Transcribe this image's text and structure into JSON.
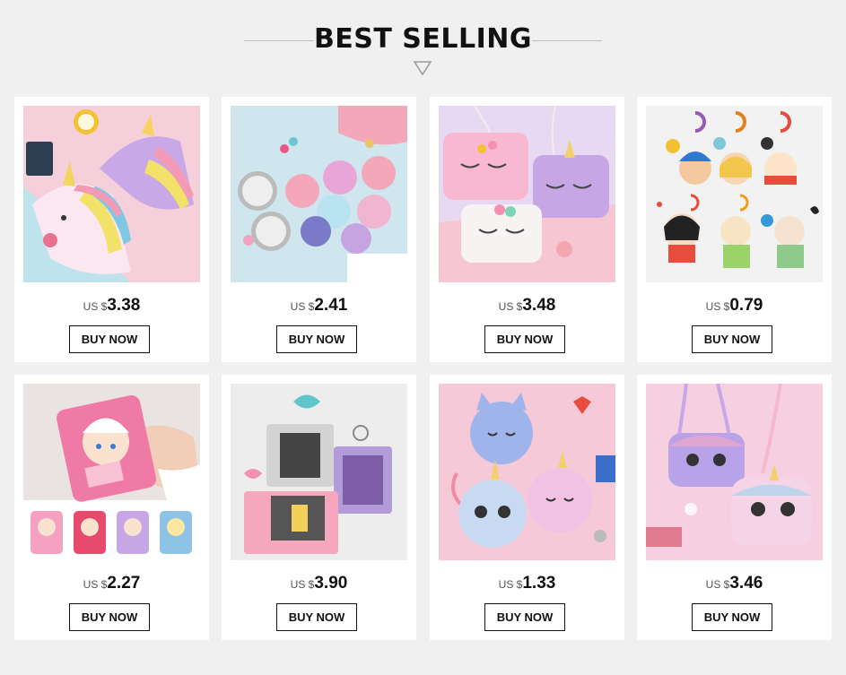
{
  "header": {
    "title": "BEST SELLING"
  },
  "products": [
    {
      "currency": "US $",
      "price": "3.38",
      "button": "BUY NOW"
    },
    {
      "currency": "US $",
      "price": "2.41",
      "button": "BUY NOW"
    },
    {
      "currency": "US $",
      "price": "3.48",
      "button": "BUY NOW"
    },
    {
      "currency": "US $",
      "price": "0.79",
      "button": "BUY NOW"
    },
    {
      "currency": "US $",
      "price": "2.27",
      "button": "BUY NOW"
    },
    {
      "currency": "US $",
      "price": "3.90",
      "button": "BUY NOW"
    },
    {
      "currency": "US $",
      "price": "1.33",
      "button": "BUY NOW"
    },
    {
      "currency": "US $",
      "price": "3.46",
      "button": "BUY NOW"
    }
  ]
}
